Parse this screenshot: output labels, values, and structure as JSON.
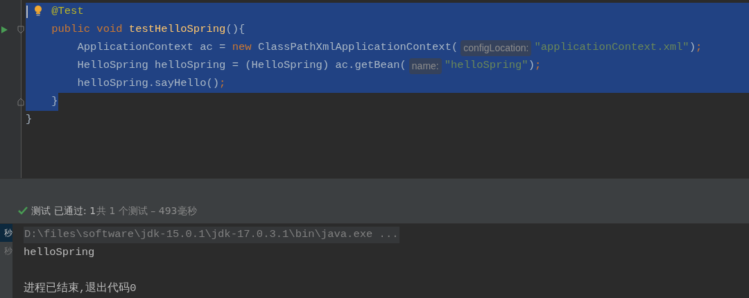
{
  "editor": {
    "lines": [
      {
        "selected": true,
        "to_line_end": true,
        "caret": true,
        "tokens": [
          {
            "kind": "annotation",
            "text": "    @Test"
          }
        ]
      },
      {
        "selected": true,
        "to_line_end": true,
        "tokens": [
          {
            "kind": "keyword",
            "text": "    public void "
          },
          {
            "kind": "method",
            "text": "testHelloSpring"
          },
          {
            "kind": "plain",
            "text": "(){"
          }
        ]
      },
      {
        "selected": true,
        "to_line_end": true,
        "tokens": [
          {
            "kind": "plain",
            "text": "        ApplicationContext ac = "
          },
          {
            "kind": "keyword",
            "text": "new "
          },
          {
            "kind": "plain",
            "text": "ClassPathXmlApplicationContext("
          },
          {
            "kind": "hint",
            "text": "configLocation:"
          },
          {
            "kind": "string",
            "text": "\"applicationContext.xml\""
          },
          {
            "kind": "plain",
            "text": ")"
          },
          {
            "kind": "punct",
            "text": ";"
          }
        ]
      },
      {
        "selected": true,
        "to_line_end": true,
        "tokens": [
          {
            "kind": "plain",
            "text": "        HelloSpring helloSpring = (HelloSpring) ac.getBean("
          },
          {
            "kind": "hint",
            "text": "name:"
          },
          {
            "kind": "string",
            "text": "\"helloSpring\""
          },
          {
            "kind": "plain",
            "text": ")"
          },
          {
            "kind": "punct",
            "text": ";"
          }
        ]
      },
      {
        "selected": true,
        "to_line_end": true,
        "tokens": [
          {
            "kind": "plain",
            "text": "        helloSpring.sayHello()"
          },
          {
            "kind": "punct",
            "text": ";"
          }
        ]
      },
      {
        "selected": true,
        "to_line_end": false,
        "tokens": [
          {
            "kind": "plain",
            "text": "    }"
          }
        ]
      },
      {
        "selected": false,
        "tokens": [
          {
            "kind": "plain",
            "text": "}"
          }
        ]
      }
    ]
  },
  "test_status": {
    "passed": true,
    "label": "测试",
    "result": "已通过: 1",
    "summary": "共 1 个测试 – 493毫秒"
  },
  "console": {
    "side_items": [
      {
        "text": "秒",
        "selected": true
      },
      {
        "text": "秒",
        "selected": false
      }
    ],
    "lines": [
      {
        "kind": "command",
        "text": "D:\\files\\software\\jdk-15.0.1\\jdk-17.0.3.1\\bin\\java.exe ..."
      },
      {
        "kind": "output",
        "text": "helloSpring"
      },
      {
        "kind": "blank"
      },
      {
        "kind": "output",
        "text": "进程已结束,退出代码0"
      }
    ]
  }
}
